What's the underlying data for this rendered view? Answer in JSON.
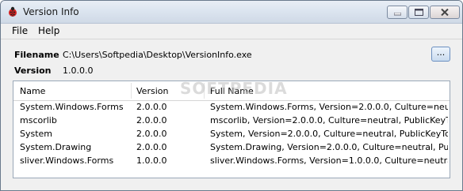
{
  "window": {
    "title": "Version Info",
    "app_icon": "ladybug-icon"
  },
  "menu": {
    "items": [
      "File",
      "Help"
    ]
  },
  "fields": {
    "filename_label": "Filename",
    "filename_value": "C:\\Users\\Softpedia\\Desktop\\VersionInfo.exe",
    "version_label": "Version",
    "version_value": "1.0.0.0",
    "browse_label": "..."
  },
  "table": {
    "columns": [
      "Name",
      "Version",
      "Full Name"
    ],
    "rows": [
      [
        "System.Windows.Forms",
        "2.0.0.0",
        "System.Windows.Forms, Version=2.0.0.0, Culture=neut..."
      ],
      [
        "mscorlib",
        "2.0.0.0",
        "mscorlib, Version=2.0.0.0, Culture=neutral, PublicKeyTo..."
      ],
      [
        "System",
        "2.0.0.0",
        "System, Version=2.0.0.0, Culture=neutral, PublicKeyTok..."
      ],
      [
        "System.Drawing",
        "2.0.0.0",
        "System.Drawing, Version=2.0.0.0, Culture=neutral, Publ..."
      ],
      [
        "sliver.Windows.Forms",
        "1.0.0.0",
        "sliver.Windows.Forms, Version=1.0.0.0, Culture=neutral..."
      ]
    ]
  },
  "watermark": "SOFTPEDIA"
}
